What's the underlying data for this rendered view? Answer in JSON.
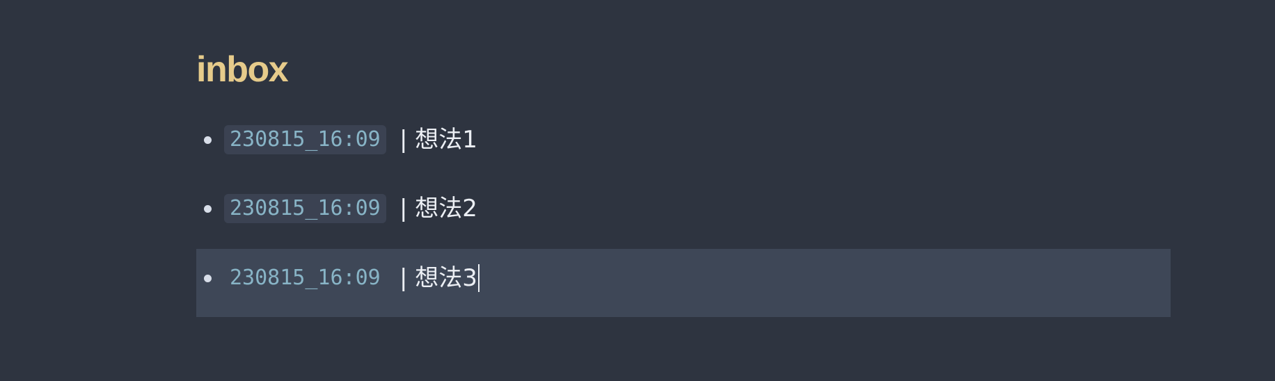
{
  "page": {
    "title": "inbox"
  },
  "items": [
    {
      "timestamp": "230815_16:09",
      "text": "| 想法1"
    },
    {
      "timestamp": "230815_16:09",
      "text": "| 想法2"
    },
    {
      "timestamp": "230815_16:09",
      "text": "| 想法3"
    }
  ],
  "colors": {
    "background": "#2e3440",
    "heading": "#e6cb8b",
    "timestamp": "#88b4c6",
    "active_line": "#3e4757"
  }
}
